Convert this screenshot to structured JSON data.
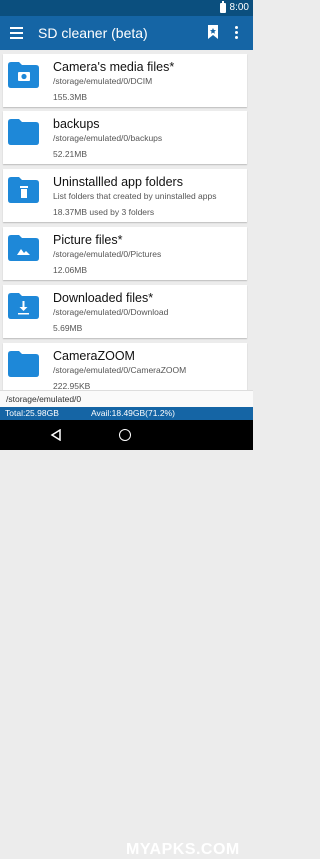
{
  "status_bar": {
    "time": "8:00"
  },
  "app_bar": {
    "title": "SD cleaner (beta)"
  },
  "folders": [
    {
      "name": "Camera's media files*",
      "path": "/storage/emulated/0/DCIM",
      "size": "155.3MB",
      "icon": "camera-folder-icon"
    },
    {
      "name": "backups",
      "path": "/storage/emulated/0/backups",
      "size": "52.21MB",
      "icon": "folder-icon"
    },
    {
      "name": "Uninstallled app folders",
      "path": "List folders that created by uninstalled apps",
      "size": "18.37MB used by 3 folders",
      "icon": "trash-folder-icon"
    },
    {
      "name": "Picture  files*",
      "path": "/storage/emulated/0/Pictures",
      "size": "12.06MB",
      "icon": "image-folder-icon"
    },
    {
      "name": "Downloaded files*",
      "path": "/storage/emulated/0/Download",
      "size": "5.69MB",
      "icon": "download-folder-icon"
    },
    {
      "name": "CameraZOOM",
      "path": "/storage/emulated/0/CameraZOOM",
      "size": "222.95KB",
      "icon": "folder-icon"
    }
  ],
  "path_bar": {
    "current_path": "/storage/emulated/0"
  },
  "storage_info": {
    "total": "Total:25.98GB",
    "available": "Avail:18.49GB(71.2%)"
  },
  "watermark": "MYAPKS.COM",
  "colors": {
    "status_bar": "#0b4f7e",
    "app_bar": "#1565a5",
    "folder_icon": "#1e88d8"
  }
}
